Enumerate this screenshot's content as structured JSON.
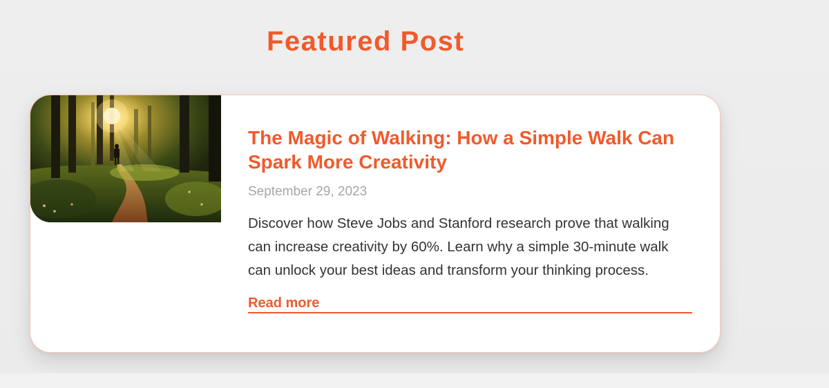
{
  "section": {
    "title": "Featured Post"
  },
  "post": {
    "title": "The Magic of Walking: How a Simple Walk Can Spark More Creativity",
    "date": "September 29, 2023",
    "excerpt": "Discover how Steve Jobs and Stanford research prove that walking can increase creativity by 60%. Learn why a simple 30-minute walk can unlock your best ideas and transform your thinking process.",
    "read_more_label": "Read more",
    "image_alt": "Person walking on a forest path at sunset"
  },
  "colors": {
    "accent": "#f15a2b",
    "date_gray": "#a6a6a6",
    "body_text": "#333333",
    "page_bg": "#ebebeb",
    "card_bg": "#ffffff"
  }
}
